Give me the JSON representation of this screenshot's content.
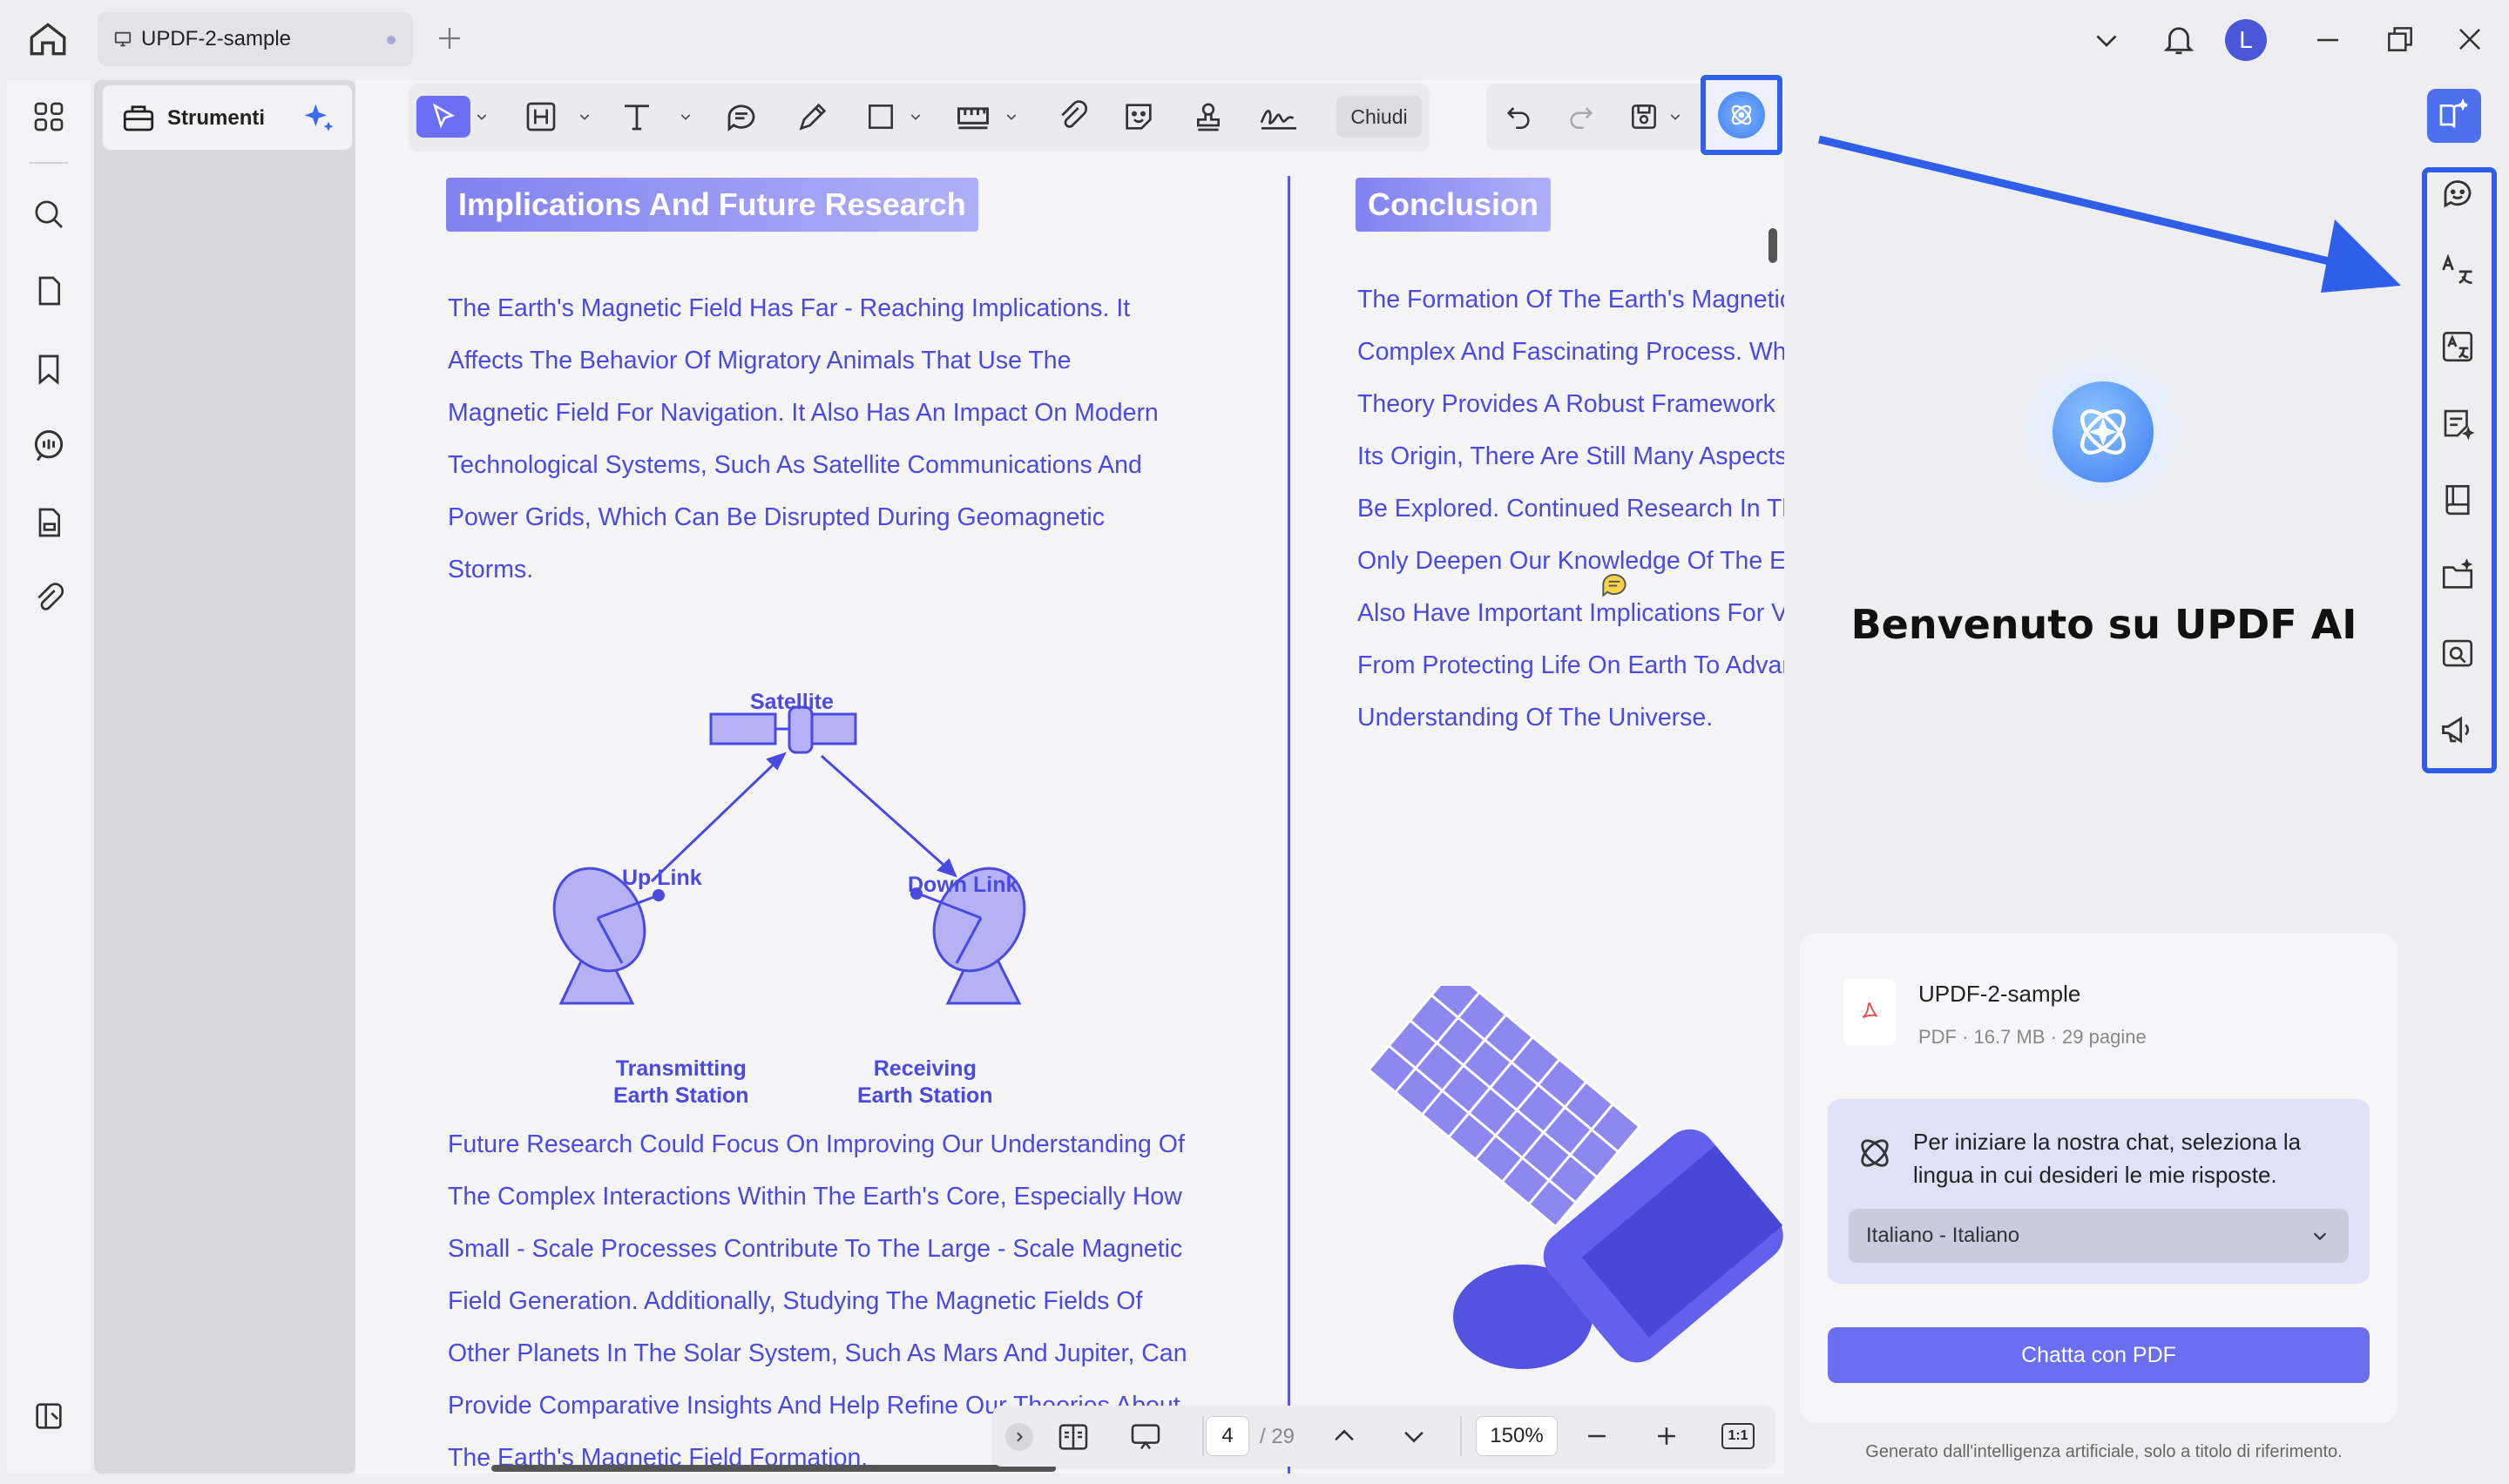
{
  "tab": {
    "title": "UPDF-2-sample"
  },
  "user": {
    "avatar_letter": "L"
  },
  "left_panel": {
    "tools_label": "Strumenti"
  },
  "toolbar": {
    "close_label": "Chiudi"
  },
  "document": {
    "section1": {
      "heading": "Implications And Future Research",
      "para1": [
        "The Earth's Magnetic Field Has Far - Reaching Implications. It",
        "Affects The Behavior Of Migratory Animals That Use The",
        "Magnetic Field For Navigation. It Also Has An Impact On Modern",
        "Technological Systems, Such As Satellite Communications And",
        "Power Grids, Which Can Be Disrupted During Geomagnetic",
        "Storms."
      ],
      "para2": [
        "Future Research Could Focus On Improving Our Understanding Of",
        "The Complex Interactions Within The Earth's Core, Especially How",
        "Small - Scale Processes Contribute To The Large - Scale Magnetic",
        "Field Generation. Additionally, Studying The Magnetic Fields Of",
        "Other Planets In The Solar System, Such As Mars And Jupiter, Can",
        "Provide Comparative Insights And Help Refine Our Theories About",
        "The Earth's Magnetic Field Formation."
      ]
    },
    "diagram": {
      "satellite": "Satellite",
      "up_link": "Up Link",
      "down_link": "Down Link",
      "tx_line1": "Transmitting",
      "tx_line2": "Earth Station",
      "rx_line1": "Receiving",
      "rx_line2": "Earth Station"
    },
    "section2": {
      "heading": "Conclusion",
      "para": [
        "The Formation Of The Earth's Magnetic",
        "Complex And Fascinating Process. Whi",
        "Theory Provides A Robust Framework F",
        "Its Origin, There Are Still Many Aspects",
        "Be Explored. Continued Research In Th",
        "Only Deepen Our Knowledge Of The Ea",
        "Also Have Important Implications For Va",
        "From Protecting Life On Earth To Advar",
        "Understanding Of The Universe."
      ]
    }
  },
  "page_nav": {
    "current_page": "4",
    "total_pages": "/ 29",
    "zoom": "150%",
    "fit_label": "1:1"
  },
  "ai_panel": {
    "welcome_title": "Benvenuto su UPDF AI",
    "file_name": "UPDF-2-sample",
    "file_meta": "PDF · 16.7 MB · 29 pagine",
    "language_prompt_line1": "Per iniziare la nostra chat, seleziona la",
    "language_prompt_line2": "lingua in cui desideri le mie risposte.",
    "language_selected": "Italiano - Italiano",
    "chat_button": "Chatta con PDF",
    "disclaimer": "Generato dall'intelligenza artificiale, solo a titolo di riferimento."
  },
  "colors": {
    "accent": "#6a6ff2",
    "doc_text": "#4a4ae0",
    "highlight_blue": "#2f5fe8"
  },
  "icons": [
    "home-icon",
    "monitor-icon",
    "plus-icon",
    "chevron-down-icon",
    "bell-icon",
    "minimize-icon",
    "restore-icon",
    "close-icon",
    "apps-icon",
    "search-icon",
    "page-icon",
    "bookmark-icon",
    "comment-icon",
    "form-icon",
    "attachment-icon",
    "sidebar-toggle-icon",
    "toolbox-icon",
    "ai-sparkle-icon",
    "pointer-icon",
    "heading-icon",
    "text-icon",
    "comment-bubble-icon",
    "pen-icon",
    "rectangle-icon",
    "measure-icon",
    "clip-icon",
    "sticker-icon",
    "stamp-icon",
    "signature-icon",
    "undo-icon",
    "redo-icon",
    "save-icon",
    "updf-ai-icon",
    "ai-book-icon",
    "ai-chat-icon",
    "translate-icon",
    "translate-alt-icon",
    "summarize-icon",
    "reader-icon",
    "folder-ai-icon",
    "search-ai-icon",
    "megaphone-icon",
    "pdf-file-icon"
  ]
}
